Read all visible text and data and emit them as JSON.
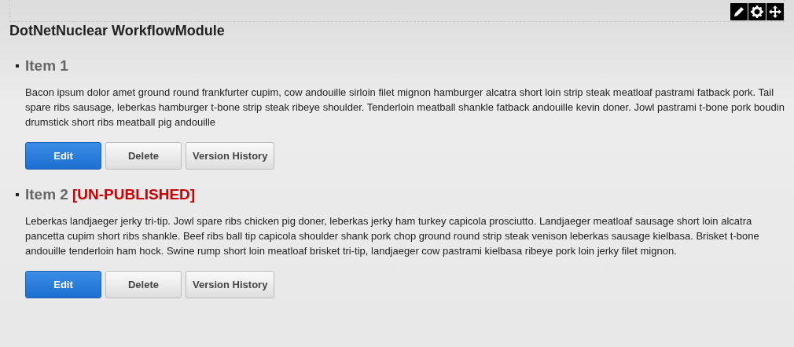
{
  "module": {
    "title": "DotNetNuclear WorkflowModule"
  },
  "items": [
    {
      "title": "Item 1",
      "body": "Bacon ipsum dolor amet ground round frankfurter cupim, cow andouille sirloin filet mignon hamburger alcatra short loin strip steak meatloaf pastrami fatback pork. Tail spare ribs sausage, leberkas hamburger t-bone strip steak ribeye shoulder. Tenderloin meatball shankle fatback andouille kevin doner. Jowl pastrami t-bone pork boudin drumstick short ribs meatball pig andouille",
      "buttons": [
        {
          "label": "Edit",
          "kind": "primary"
        },
        {
          "label": "Delete",
          "kind": "default"
        },
        {
          "label": "Version History",
          "kind": "default"
        }
      ]
    },
    {
      "title": "Item 2",
      "status": "[UN-PUBLISHED]",
      "body": "Leberkas landjaeger jerky tri-tip. Jowl spare ribs chicken pig doner, leberkas jerky ham turkey capicola prosciutto. Landjaeger meatloaf sausage short loin alcatra pancetta cupim short ribs shankle. Beef ribs ball tip capicola shoulder shank pork chop ground round strip steak venison leberkas sausage kielbasa. Brisket t-bone andouille tenderloin ham hock. Swine rump short loin meatloaf brisket tri-tip, landjaeger cow pastrami kielbasa ribeye pork loin jerky filet mignon.",
      "buttons": [
        {
          "label": "Edit",
          "kind": "primary"
        },
        {
          "label": "Delete",
          "kind": "default"
        },
        {
          "label": "Version History",
          "kind": "default"
        }
      ]
    }
  ]
}
